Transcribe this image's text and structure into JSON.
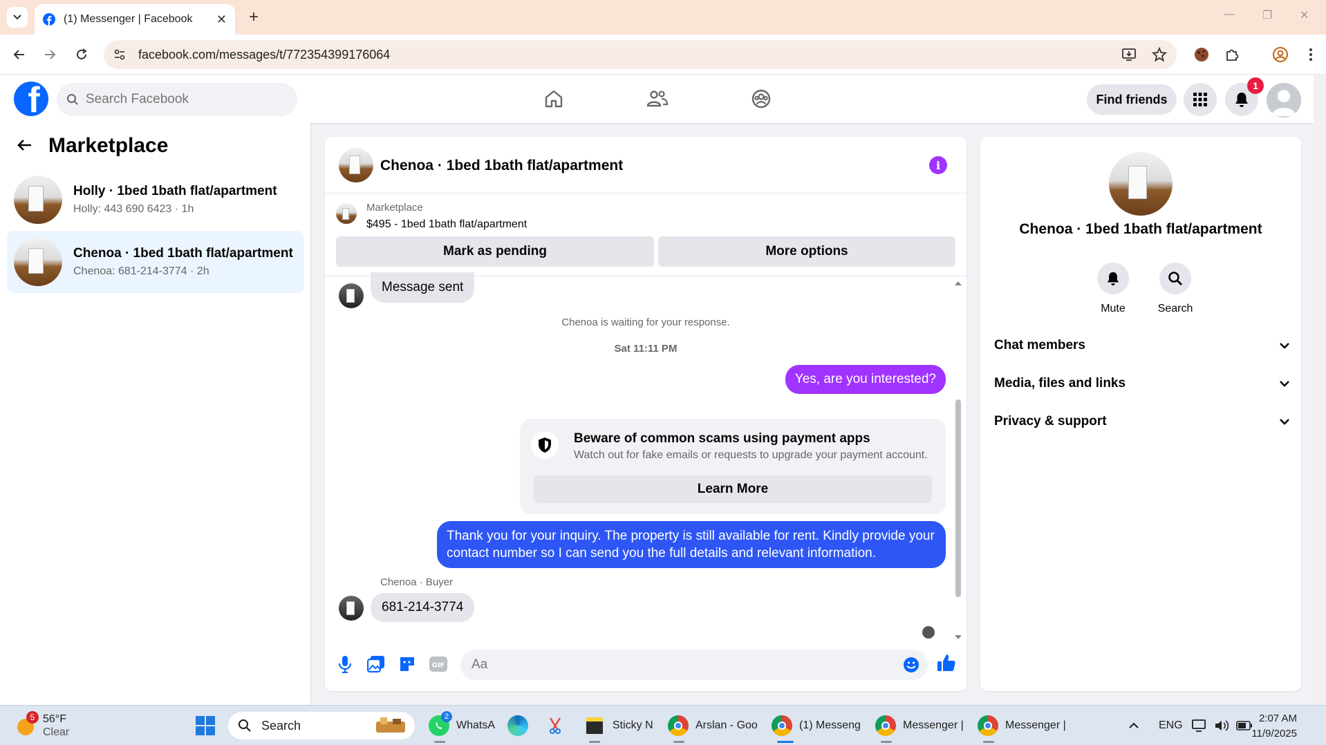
{
  "browser": {
    "tab_title": "(1) Messenger | Facebook",
    "url": "facebook.com/messages/t/772354399176064"
  },
  "fb_header": {
    "logo_letter": "f",
    "search_placeholder": "Search Facebook",
    "find_friends": "Find friends",
    "notification_count": "1"
  },
  "sidebar": {
    "title": "Marketplace",
    "conversations": [
      {
        "name": "Holly · 1bed 1bath flat/apartment",
        "preview": "Holly: 443 690 6423 · 1h",
        "active": false
      },
      {
        "name": "Chenoa · 1bed 1bath flat/apartment",
        "preview": "Chenoa: 681-214-3774 · 2h",
        "active": true
      }
    ]
  },
  "chat": {
    "title": "Chenoa · 1bed 1bath flat/apartment",
    "listing": {
      "label": "Marketplace",
      "title": "$495 - 1bed 1bath flat/apartment",
      "mark_pending": "Mark as pending",
      "more_options": "More options"
    },
    "messages": {
      "sent_preview": "Message sent",
      "waiting": "Chenoa is waiting for your response.",
      "timestamp": "Sat 11:11 PM",
      "out_1": "Yes, are you interested?",
      "warning_title": "Beware of common scams using payment apps",
      "warning_desc": "Watch out for fake emails or requests to upgrade your payment account.",
      "learn_more": "Learn More",
      "out_2_line1": "Thank you for your inquiry. The property is still available for rent. Kindly provide your",
      "out_2_line2": "contact number so I can send you the full details and relevant information.",
      "sender_label": "Chenoa · Buyer",
      "in_1": "681-214-3774"
    },
    "composer_placeholder": "Aa",
    "colors": {
      "bubble_purple": "#a033ff",
      "bubble_blue": "#0866ff",
      "bubble_gray": "#e4e6eb"
    }
  },
  "right_panel": {
    "name": "Chenoa · 1bed 1bath flat/apartment",
    "actions": {
      "mute": "Mute",
      "search": "Search"
    },
    "sections": [
      "Chat members",
      "Media, files and links",
      "Privacy & support"
    ]
  },
  "taskbar": {
    "weather_badge": "5",
    "temp": "56°F",
    "condition": "Clear",
    "search": "Search",
    "whatsapp_badge": "2",
    "apps": [
      "WhatsA",
      "Sticky N",
      "Arslan - Goo",
      "(1) Messeng",
      "Messenger |",
      "Messenger |"
    ],
    "lang": "ENG",
    "time": "2:07 AM",
    "date": "11/9/2025"
  }
}
